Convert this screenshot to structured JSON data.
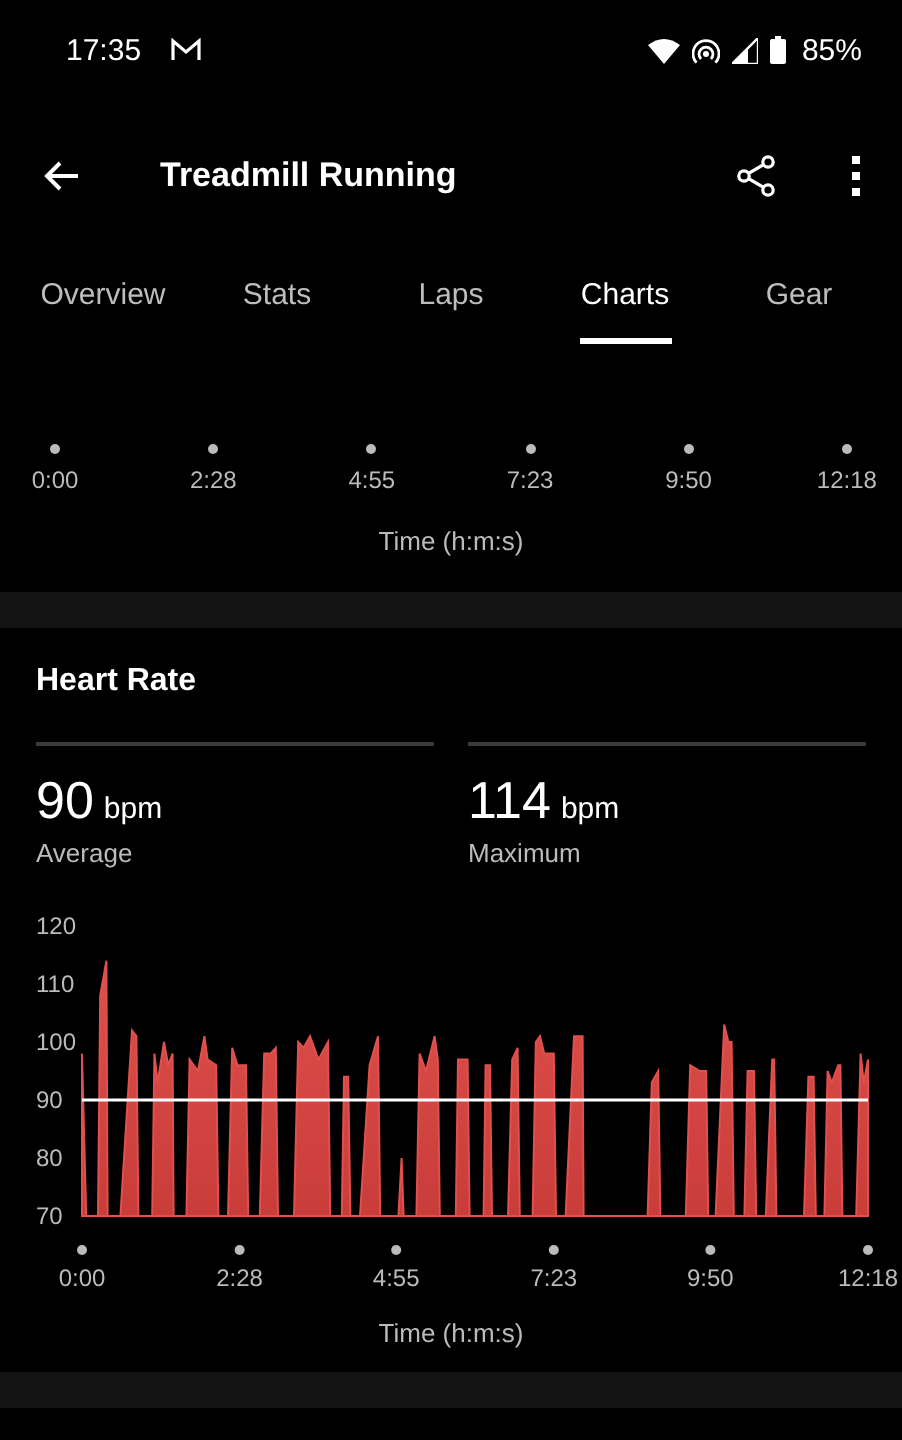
{
  "status_bar": {
    "time": "17:35",
    "battery": "85%"
  },
  "app_bar": {
    "title": "Treadmill Running"
  },
  "tabs": [
    {
      "label": "Overview",
      "selected": false
    },
    {
      "label": "Stats",
      "selected": false
    },
    {
      "label": "Laps",
      "selected": false
    },
    {
      "label": "Charts",
      "selected": true
    },
    {
      "label": "Gear",
      "selected": false
    }
  ],
  "previous_chart_axis": {
    "ticks": [
      "0:00",
      "2:28",
      "4:55",
      "7:23",
      "9:50",
      "12:18"
    ],
    "xlabel": "Time (h:m:s)"
  },
  "heart_rate": {
    "title": "Heart Rate",
    "stats": [
      {
        "value": "90",
        "unit": "bpm",
        "label": "Average"
      },
      {
        "value": "114",
        "unit": "bpm",
        "label": "Maximum"
      }
    ],
    "chart_data": {
      "type": "area",
      "xlabel": "Time (h:m:s)",
      "xlim": [
        0,
        738
      ],
      "ylim": [
        70,
        120
      ],
      "x": [
        0,
        4,
        15,
        17,
        23,
        24,
        36,
        47,
        51,
        53,
        66,
        68,
        71,
        77,
        81,
        85,
        86,
        98,
        101,
        109,
        115,
        118,
        126,
        128,
        137,
        141,
        146,
        154,
        156,
        167,
        171,
        177,
        182,
        184,
        199,
        203,
        208,
        214,
        222,
        231,
        233,
        244,
        246,
        250,
        252,
        261,
        270,
        278,
        280,
        291,
        297,
        300,
        302,
        314,
        317,
        323,
        331,
        334,
        336,
        351,
        353,
        362,
        364,
        377,
        379,
        383,
        385,
        400,
        404,
        409,
        411,
        423,
        426,
        430,
        434,
        443,
        445,
        454,
        462,
        470,
        471,
        486,
        531,
        535,
        541,
        543,
        567,
        571,
        580,
        586,
        588,
        595,
        603,
        607,
        610,
        612,
        622,
        625,
        631,
        633,
        642,
        648,
        650,
        652,
        678,
        682,
        687,
        689,
        697,
        700,
        704,
        710,
        712,
        714,
        727,
        731,
        734,
        738
      ],
      "series": [
        {
          "color": "#e0504c",
          "values": [
            98,
            70,
            70,
            108,
            114,
            70,
            70,
            102,
            101,
            70,
            70,
            98,
            93,
            100,
            96,
            98,
            70,
            70,
            97,
            95,
            101,
            97,
            96,
            70,
            70,
            99,
            96,
            96,
            70,
            70,
            98,
            98,
            99,
            70,
            70,
            100,
            99,
            101,
            97,
            100,
            70,
            70,
            94,
            94,
            70,
            70,
            96,
            101,
            70,
            70,
            70,
            80,
            70,
            70,
            98,
            95,
            101,
            97,
            70,
            70,
            97,
            97,
            70,
            70,
            96,
            96,
            70,
            70,
            97,
            99,
            70,
            70,
            100,
            101,
            98,
            98,
            70,
            70,
            101,
            101,
            70,
            70,
            70,
            93,
            95,
            70,
            70,
            96,
            95,
            95,
            70,
            70,
            103,
            100,
            100,
            70,
            70,
            95,
            95,
            70,
            70,
            97,
            97,
            70,
            70,
            94,
            94,
            70,
            70,
            95,
            93,
            96,
            96,
            70,
            70,
            98,
            93,
            97
          ]
        }
      ],
      "xticks": [
        {
          "value": 0,
          "label": "0:00"
        },
        {
          "value": 148,
          "label": "2:28"
        },
        {
          "value": 295,
          "label": "4:55"
        },
        {
          "value": 443,
          "label": "7:23"
        },
        {
          "value": 590,
          "label": "9:50"
        },
        {
          "value": 738,
          "label": "12:18"
        }
      ],
      "yticks": [
        70,
        80,
        90,
        100,
        110,
        120
      ],
      "ref_lines": [
        {
          "axis": "y",
          "value": 90
        }
      ]
    }
  }
}
